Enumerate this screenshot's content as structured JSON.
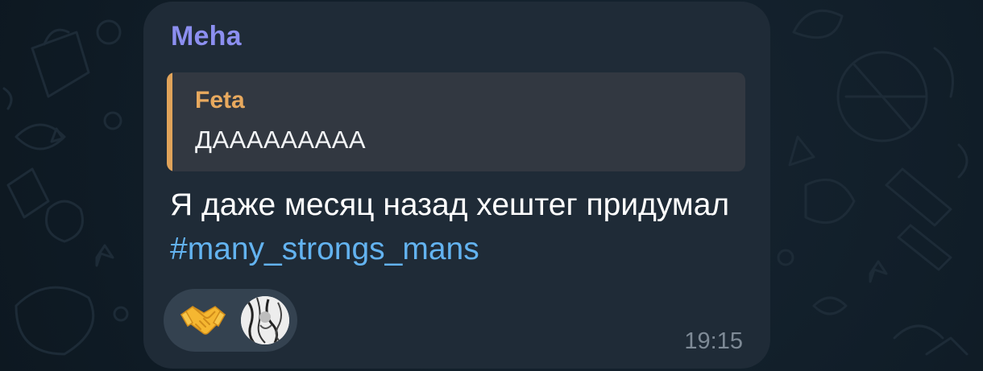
{
  "message": {
    "sender": "Meha",
    "reply": {
      "author": "Feta",
      "text": "ДААААААААА"
    },
    "text_before_hashtag": "Я даже месяц назад хештег придумал ",
    "hashtag": "#many_strongs_mans",
    "time": "19:15",
    "reactions": [
      {
        "emoji": "handshake-icon",
        "reactor": "user-avatar"
      }
    ]
  },
  "colors": {
    "background": "#0f1c27",
    "bubble": "#1f2b37",
    "sender": "#8c8ff0",
    "reply_accent": "#e0a35a",
    "hashtag": "#63b3f0",
    "time": "#7e8a96"
  }
}
